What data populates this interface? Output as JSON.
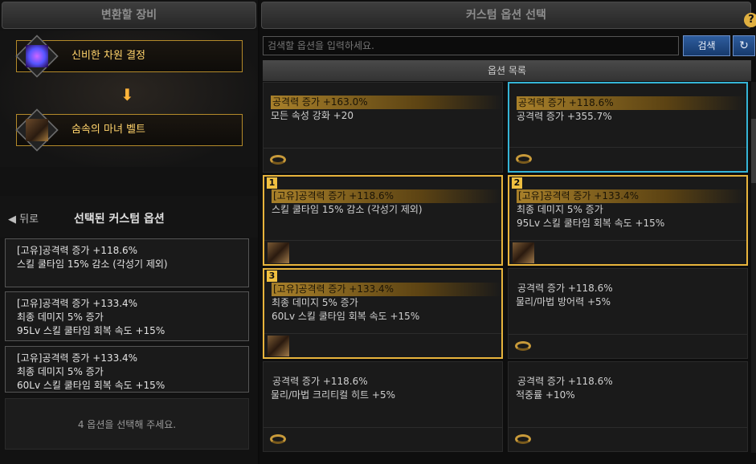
{
  "left": {
    "title": "변환할 장비",
    "slot1_label": "신비한 차원 결정",
    "slot2_label": "숨속의 마녀 벨트",
    "arrow": "⬇",
    "back_label": "◀ 뒤로",
    "selected_title": "선택된 커스텀 옵션",
    "selected": [
      {
        "lines": [
          "[고유]공격력 증가 +118.6%",
          "스킬 쿨타임 15% 감소 (각성기 제외)"
        ]
      },
      {
        "lines": [
          "[고유]공격력 증가 +133.4%",
          "최종 데미지 5% 증가",
          "95Lv 스킬 쿨타임 회복 속도 +15%"
        ]
      },
      {
        "lines": [
          "[고유]공격력 증가 +133.4%",
          "최종 데미지 5% 증가",
          "60Lv 스킬 쿨타임 회복 속도 +15%"
        ]
      }
    ],
    "empty_prompt": "4 옵션을 선택해 주세요."
  },
  "right": {
    "title": "커스텀 옵션 선택",
    "help": "?",
    "search_placeholder": "검색할 옵션을 입력하세요.",
    "search_button": "검색",
    "refresh_icon": "↻",
    "list_header": "옵션 목록",
    "cards": [
      {
        "num": "",
        "state": "normal",
        "icon": "ring",
        "highlight": true,
        "lines": [
          "공격력 증가 +163.0%",
          "모든 속성 강화 +20"
        ]
      },
      {
        "num": "",
        "state": "current",
        "icon": "ring",
        "highlight": true,
        "lines": [
          "공격력 증가 +118.6%",
          "공격력 증가 +355.7%"
        ]
      },
      {
        "num": "1",
        "state": "selected",
        "icon": "belt",
        "highlight": true,
        "lines": [
          "[고유]공격력 증가 +118.6%",
          "스킬 쿨타임 15% 감소 (각성기 제외)"
        ]
      },
      {
        "num": "2",
        "state": "selected",
        "icon": "belt",
        "highlight": true,
        "lines": [
          "[고유]공격력 증가 +133.4%",
          "최종 데미지 5% 증가",
          "95Lv 스킬 쿨타임 회복 속도 +15%"
        ]
      },
      {
        "num": "3",
        "state": "selected",
        "icon": "belt",
        "highlight": true,
        "lines": [
          "[고유]공격력 증가 +133.4%",
          "최종 데미지 5% 증가",
          "60Lv 스킬 쿨타임 회복 속도 +15%"
        ]
      },
      {
        "num": "",
        "state": "normal",
        "icon": "ring",
        "highlight": false,
        "lines": [
          "공격력 증가 +118.6%",
          "물리/마법 방어력 +5%"
        ]
      },
      {
        "num": "",
        "state": "normal",
        "icon": "ring",
        "highlight": false,
        "lines": [
          "공격력 증가 +118.6%",
          "물리/마법 크리티컬 히트 +5%"
        ]
      },
      {
        "num": "",
        "state": "normal",
        "icon": "ring",
        "highlight": false,
        "lines": [
          "공격력 증가 +118.6%",
          "적중률 +10%"
        ]
      }
    ]
  }
}
